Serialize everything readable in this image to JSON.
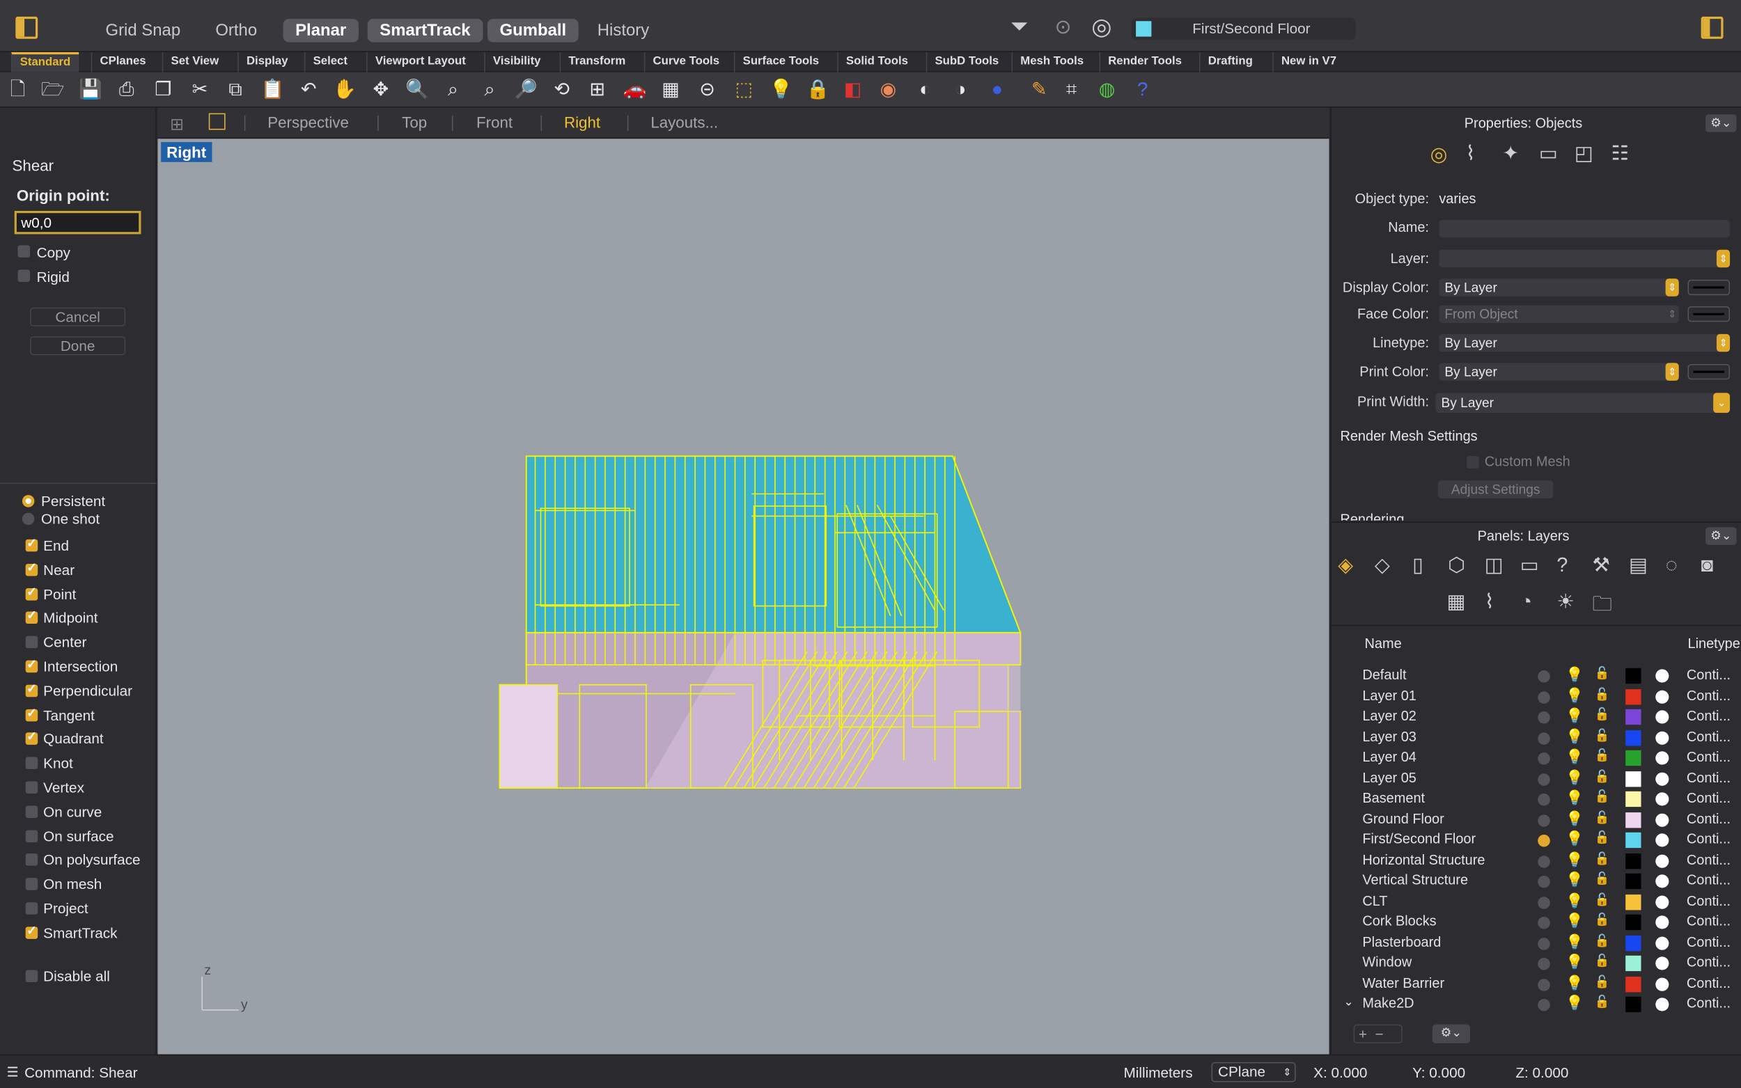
{
  "topbar": {
    "toggles": [
      {
        "label": "Grid Snap",
        "on": false
      },
      {
        "label": "Ortho",
        "on": false
      },
      {
        "label": "Planar",
        "on": true
      },
      {
        "label": "SmartTrack",
        "on": true
      },
      {
        "label": "Gumball",
        "on": true
      },
      {
        "label": "History",
        "on": false
      }
    ],
    "current_layer": "First/Second Floor",
    "current_layer_color": "#67d9ee"
  },
  "tabs": [
    "Standard",
    "CPlanes",
    "Set View",
    "Display",
    "Select",
    "Viewport Layout",
    "Visibility",
    "Transform",
    "Curve Tools",
    "Surface Tools",
    "Solid Tools",
    "SubD Tools",
    "Mesh Tools",
    "Render Tools",
    "Drafting",
    "New in V7"
  ],
  "command": {
    "title": "Shear",
    "prompt": "Origin point:",
    "input": "w0,0",
    "copy_label": "Copy",
    "rigid_label": "Rigid",
    "cancel": "Cancel",
    "done": "Done"
  },
  "osnap": {
    "persistent": "Persistent",
    "one_shot": "One shot",
    "items": [
      {
        "label": "End",
        "on": true
      },
      {
        "label": "Near",
        "on": true
      },
      {
        "label": "Point",
        "on": true
      },
      {
        "label": "Midpoint",
        "on": true
      },
      {
        "label": "Center",
        "on": false
      },
      {
        "label": "Intersection",
        "on": true
      },
      {
        "label": "Perpendicular",
        "on": true
      },
      {
        "label": "Tangent",
        "on": true
      },
      {
        "label": "Quadrant",
        "on": true
      },
      {
        "label": "Knot",
        "on": false
      },
      {
        "label": "Vertex",
        "on": false
      },
      {
        "label": "On curve",
        "on": false
      },
      {
        "label": "On surface",
        "on": false
      },
      {
        "label": "On polysurface",
        "on": false
      },
      {
        "label": "On mesh",
        "on": false
      },
      {
        "label": "Project",
        "on": false
      },
      {
        "label": "SmartTrack",
        "on": true
      }
    ],
    "disable_all": "Disable all"
  },
  "viewport": {
    "tabs": [
      "Perspective",
      "Top",
      "Front",
      "Right",
      "Layouts..."
    ],
    "active": "Right",
    "label": "Right",
    "axis_z": "z",
    "axis_y": "y"
  },
  "properties": {
    "title": "Properties: Objects",
    "object_type_label": "Object type:",
    "object_type": "varies",
    "name_label": "Name:",
    "layer_label": "Layer:",
    "display_color_label": "Display Color:",
    "display_color": "By Layer",
    "face_color_label": "Face Color:",
    "face_color": "From Object",
    "linetype_label": "Linetype:",
    "linetype": "By Layer",
    "print_color_label": "Print Color:",
    "print_color": "By Layer",
    "print_width_label": "Print Width:",
    "print_width": "By Layer",
    "render_mesh": "Render Mesh Settings",
    "custom_mesh": "Custom Mesh",
    "adjust": "Adjust Settings",
    "rendering": "Rendering"
  },
  "layers": {
    "title": "Panels: Layers",
    "col_name": "Name",
    "col_linetype": "Linetype",
    "rows": [
      {
        "name": "Default",
        "color": "#000000",
        "current": false,
        "on": true
      },
      {
        "name": "Layer 01",
        "color": "#e0301e",
        "current": false,
        "on": true
      },
      {
        "name": "Layer 02",
        "color": "#7b46d8",
        "current": false,
        "on": true
      },
      {
        "name": "Layer 03",
        "color": "#1846f0",
        "current": false,
        "on": true
      },
      {
        "name": "Layer 04",
        "color": "#27a22c",
        "current": false,
        "on": true
      },
      {
        "name": "Layer 05",
        "color": "#ffffff",
        "current": false,
        "on": true
      },
      {
        "name": "Basement",
        "color": "#fcf6a8",
        "current": false,
        "on": false
      },
      {
        "name": "Ground Floor",
        "color": "#eed6ef",
        "current": false,
        "on": true
      },
      {
        "name": "First/Second Floor",
        "color": "#5ed4ee",
        "current": true,
        "on": true
      },
      {
        "name": "Horizontal Structure",
        "color": "#000000",
        "current": false,
        "on": false
      },
      {
        "name": "Vertical Structure",
        "color": "#000000",
        "current": false,
        "on": false
      },
      {
        "name": "CLT",
        "color": "#f6c23c",
        "current": false,
        "on": false
      },
      {
        "name": "Cork Blocks",
        "color": "#000000",
        "current": false,
        "on": false
      },
      {
        "name": "Plasterboard",
        "color": "#1846f0",
        "current": false,
        "on": false
      },
      {
        "name": "Window",
        "color": "#9cf0d6",
        "current": false,
        "on": false
      },
      {
        "name": "Water Barrier",
        "color": "#e0301e",
        "current": false,
        "on": false
      },
      {
        "name": "Make2D",
        "color": "#000000",
        "current": false,
        "on": true
      }
    ],
    "linetype": "Conti..."
  },
  "status": {
    "command": "Command: Shear",
    "units": "Millimeters",
    "cplane": "CPlane",
    "x": "X: 0.000",
    "y": "Y: 0.000",
    "z": "Z: 0.000"
  }
}
